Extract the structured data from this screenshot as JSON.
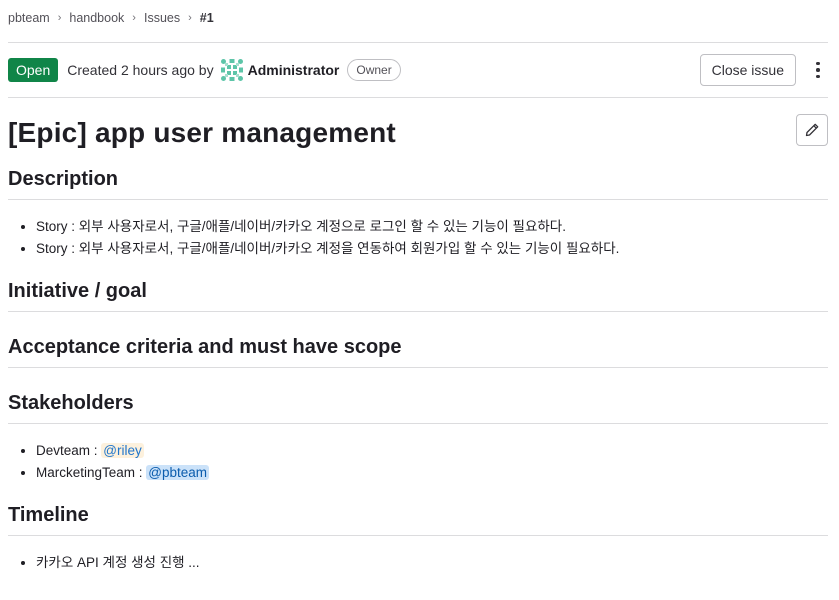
{
  "breadcrumb": {
    "items": [
      "pbteam",
      "handbook",
      "Issues"
    ],
    "current": "#1",
    "separator": "›"
  },
  "header": {
    "status": "Open",
    "created_text": "Created 2 hours ago by",
    "author": "Administrator",
    "role": "Owner",
    "close_label": "Close issue"
  },
  "issue": {
    "title": "[Epic] app user management"
  },
  "sections": {
    "description": {
      "heading": "Description",
      "items": [
        "Story : 외부 사용자로서, 구글/애플/네이버/카카오 계정으로 로그인 할 수 있는 기능이 필요하다.",
        "Story : 외부 사용자로서, 구글/애플/네이버/카카오 계정을 연동하여 회원가입 할 수 있는 기능이 필요하다."
      ]
    },
    "initiative": {
      "heading": "Initiative / goal"
    },
    "acceptance": {
      "heading": "Acceptance criteria and must have scope"
    },
    "stakeholders": {
      "heading": "Stakeholders",
      "items": [
        {
          "label": "Devteam : ",
          "mention": "@riley"
        },
        {
          "label": "MarcketingTeam : ",
          "mention": "@pbteam"
        }
      ]
    },
    "timeline": {
      "heading": "Timeline",
      "items": [
        "카카오 API 계정 생성 진행 ..."
      ]
    }
  },
  "colors": {
    "status_green": "#108548",
    "mention_riley_bg": "#fdf1dd",
    "mention_pbteam_bg": "#cbe2f9",
    "link_blue": "#1f75cb"
  },
  "icons": {
    "avatar": "identicon-avatar",
    "edit": "pencil-icon",
    "more": "vertical-ellipsis-icon"
  }
}
